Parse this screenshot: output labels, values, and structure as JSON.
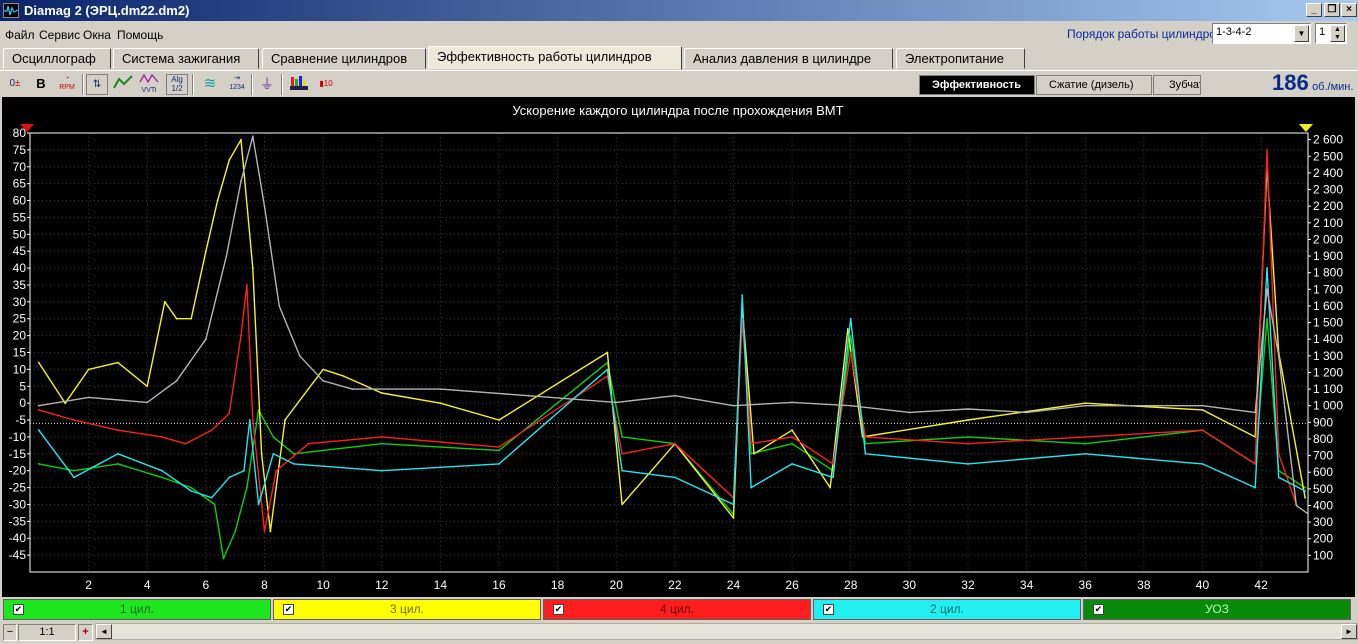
{
  "window": {
    "title": "Diamag 2 (ЭРЦ.dm22.dm2)",
    "minimize": "_",
    "restore": "❐",
    "close": "×"
  },
  "menu": [
    "Файл",
    "Сервис",
    "Окна",
    "Помощь"
  ],
  "cylinder_order": {
    "label": "Порядок работы цилиндров",
    "value": "1-3-4-2",
    "spin_value": "1"
  },
  "tabs": [
    "Осциллограф",
    "Система зажигания",
    "Сравнение цилиндров",
    "Эффективность работы цилиндров",
    "Анализ давления в цилиндре",
    "Электропитание"
  ],
  "active_tab": "Эффективность работы цилиндров",
  "toolbar_icons": [
    "zero-level-icon",
    "bold-b-icon",
    "rpm-gauge-icon",
    "cylinder-numbers-icon",
    "line-mode-icon",
    "vvti-icon",
    "algorithm-half-icon",
    "waveform-icon",
    "sequence-1234-icon",
    "filter-icon",
    "bars-engine-icon",
    "counter-10-icon"
  ],
  "toolbar_texts": {
    "zero": "0",
    "bold": "B",
    "rpm": "RPM",
    "seq": "1234",
    "alg": "Alg",
    "half": "1/2",
    "vvti": "VVTi",
    "ten": "10"
  },
  "subtabs": [
    "Эффективность",
    "Сжатие (дизель)",
    "Зубчат"
  ],
  "active_subtab": "Эффективность",
  "rpm": {
    "value": "186",
    "unit": "об./мин."
  },
  "chart_data": {
    "type": "line",
    "title": "Ускорение каждого цилиндра после прохождения ВМТ",
    "x_ticks": [
      2,
      4,
      6,
      8,
      10,
      12,
      14,
      16,
      18,
      20,
      22,
      24,
      26,
      28,
      30,
      32,
      34,
      36,
      38,
      40,
      42
    ],
    "xlim": [
      0,
      43.6
    ],
    "y_left_ticks": [
      80,
      75,
      70,
      65,
      60,
      55,
      50,
      45,
      40,
      35,
      30,
      25,
      20,
      15,
      10,
      5,
      0,
      -5,
      -10,
      -15,
      -20,
      -25,
      -30,
      -35,
      -40,
      -45
    ],
    "y_left_lim": [
      -50,
      80
    ],
    "y_right_ticks": [
      "2 600",
      "2 500",
      "2 400",
      "2 300",
      "2 200",
      "2 100",
      "2 000",
      "1 900",
      "1 800",
      "1 700",
      "1 600",
      "1 500",
      "1 400",
      "1 300",
      "1 200",
      "1 100",
      "1 000",
      "900",
      "800",
      "700",
      "600",
      "500",
      "400",
      "300",
      "200",
      "100"
    ],
    "y_right_lim": [
      0,
      2640
    ],
    "reference_line_y": -6,
    "grid": true,
    "series": [
      {
        "name": "1 цил.",
        "color": "#0cd10c",
        "axis": "left",
        "points": [
          [
            0.3,
            -18
          ],
          [
            1.5,
            -20
          ],
          [
            3,
            -18
          ],
          [
            4.5,
            -22
          ],
          [
            5.5,
            -25
          ],
          [
            6.3,
            -30
          ],
          [
            6.6,
            -46
          ],
          [
            7.0,
            -38
          ],
          [
            7.4,
            -25
          ],
          [
            7.8,
            -2
          ],
          [
            8.3,
            -10
          ],
          [
            9,
            -15
          ],
          [
            12,
            -12
          ],
          [
            16,
            -14
          ],
          [
            19.7,
            12
          ],
          [
            20.2,
            -10
          ],
          [
            22,
            -12
          ],
          [
            24.0,
            -33
          ],
          [
            24.3,
            30
          ],
          [
            24.6,
            -15
          ],
          [
            26,
            -12
          ],
          [
            27.4,
            -20
          ],
          [
            28.0,
            20
          ],
          [
            28.5,
            -12
          ],
          [
            32,
            -10
          ],
          [
            36,
            -12
          ],
          [
            40,
            -8
          ],
          [
            41.8,
            -18
          ],
          [
            42.2,
            25
          ],
          [
            42.6,
            -20
          ],
          [
            43.5,
            -25
          ]
        ]
      },
      {
        "name": "3 цил.",
        "color": "#f4f426",
        "axis": "left",
        "points": [
          [
            0.3,
            12
          ],
          [
            1.2,
            0
          ],
          [
            2,
            10
          ],
          [
            3,
            12
          ],
          [
            4,
            5
          ],
          [
            4.6,
            30
          ],
          [
            5.0,
            25
          ],
          [
            5.5,
            25
          ],
          [
            6.0,
            45
          ],
          [
            6.4,
            60
          ],
          [
            6.8,
            72
          ],
          [
            7.2,
            78
          ],
          [
            7.6,
            40
          ],
          [
            7.9,
            -15
          ],
          [
            8.2,
            -38
          ],
          [
            8.7,
            -5
          ],
          [
            10,
            10
          ],
          [
            10.7,
            8
          ],
          [
            12,
            3
          ],
          [
            14,
            0
          ],
          [
            16,
            -5
          ],
          [
            19.7,
            15
          ],
          [
            20.2,
            -30
          ],
          [
            22,
            -12
          ],
          [
            24.0,
            -34
          ],
          [
            24.3,
            28
          ],
          [
            24.7,
            -15
          ],
          [
            26,
            -8
          ],
          [
            27.3,
            -25
          ],
          [
            27.9,
            22
          ],
          [
            28.4,
            -10
          ],
          [
            32,
            -5
          ],
          [
            36,
            0
          ],
          [
            40,
            -2
          ],
          [
            41.8,
            -10
          ],
          [
            42.2,
            70
          ],
          [
            42.6,
            15
          ],
          [
            43.5,
            -28
          ]
        ]
      },
      {
        "name": "4 цил.",
        "color": "#ff1e1e",
        "axis": "left",
        "points": [
          [
            0.3,
            -2
          ],
          [
            1.5,
            -5
          ],
          [
            3,
            -8
          ],
          [
            4.5,
            -10
          ],
          [
            5.3,
            -12
          ],
          [
            6.2,
            -8
          ],
          [
            6.8,
            -3
          ],
          [
            7.2,
            20
          ],
          [
            7.4,
            35
          ],
          [
            7.6,
            -5
          ],
          [
            8.0,
            -38
          ],
          [
            8.4,
            -20
          ],
          [
            9.5,
            -12
          ],
          [
            12,
            -10
          ],
          [
            16,
            -13
          ],
          [
            19.7,
            8
          ],
          [
            20.2,
            -15
          ],
          [
            22,
            -12
          ],
          [
            24.0,
            -28
          ],
          [
            24.3,
            25
          ],
          [
            24.6,
            -12
          ],
          [
            26,
            -10
          ],
          [
            27.4,
            -18
          ],
          [
            28.0,
            15
          ],
          [
            28.5,
            -10
          ],
          [
            32,
            -12
          ],
          [
            36,
            -10
          ],
          [
            40,
            -8
          ],
          [
            41.8,
            -18
          ],
          [
            42.2,
            75
          ],
          [
            42.6,
            -15
          ],
          [
            43.2,
            -30
          ]
        ]
      },
      {
        "name": "2 цил.",
        "color": "#20e8f0",
        "axis": "left",
        "points": [
          [
            0.3,
            -8
          ],
          [
            1.5,
            -22
          ],
          [
            3,
            -15
          ],
          [
            4.5,
            -20
          ],
          [
            5.5,
            -26
          ],
          [
            6.2,
            -28
          ],
          [
            6.8,
            -22
          ],
          [
            7.3,
            -20
          ],
          [
            7.5,
            -5
          ],
          [
            7.8,
            -30
          ],
          [
            8.3,
            -15
          ],
          [
            9,
            -18
          ],
          [
            12,
            -20
          ],
          [
            16,
            -18
          ],
          [
            19.7,
            10
          ],
          [
            20.2,
            -20
          ],
          [
            22,
            -22
          ],
          [
            24.0,
            -30
          ],
          [
            24.3,
            32
          ],
          [
            24.6,
            -25
          ],
          [
            26,
            -18
          ],
          [
            27.4,
            -22
          ],
          [
            28.0,
            25
          ],
          [
            28.5,
            -15
          ],
          [
            32,
            -18
          ],
          [
            36,
            -15
          ],
          [
            40,
            -18
          ],
          [
            41.8,
            -25
          ],
          [
            42.2,
            40
          ],
          [
            42.6,
            -22
          ],
          [
            43.5,
            -26
          ]
        ]
      },
      {
        "name": "УОЗ",
        "color": "#b4b4b4",
        "axis": "right",
        "points": [
          [
            0.3,
            1000
          ],
          [
            2,
            1050
          ],
          [
            4,
            1020
          ],
          [
            5,
            1150
          ],
          [
            6,
            1400
          ],
          [
            6.7,
            1900
          ],
          [
            7.2,
            2350
          ],
          [
            7.6,
            2620
          ],
          [
            8.0,
            2200
          ],
          [
            8.5,
            1600
          ],
          [
            9.2,
            1300
          ],
          [
            10,
            1150
          ],
          [
            11,
            1100
          ],
          [
            14,
            1100
          ],
          [
            17,
            1060
          ],
          [
            20,
            1020
          ],
          [
            22,
            1060
          ],
          [
            24,
            1000
          ],
          [
            26,
            1020
          ],
          [
            28,
            1000
          ],
          [
            30,
            960
          ],
          [
            32,
            980
          ],
          [
            34,
            960
          ],
          [
            36,
            1000
          ],
          [
            38,
            1000
          ],
          [
            40,
            1000
          ],
          [
            41.8,
            960
          ],
          [
            42.2,
            1700
          ],
          [
            42.6,
            1300
          ],
          [
            43.2,
            400
          ],
          [
            43.6,
            350
          ]
        ]
      }
    ]
  },
  "legend": [
    {
      "label": "1 цил.",
      "color": "#1ee61e",
      "text_color": "#1a6a1a"
    },
    {
      "label": "3 цил.",
      "color": "#ffff00",
      "text_color": "#6a6a00"
    },
    {
      "label": "4 цил.",
      "color": "#ff1e1e",
      "text_color": "#6a0000"
    },
    {
      "label": "2 цил.",
      "color": "#22f0f0",
      "text_color": "#006a6a"
    },
    {
      "label": "УОЗ",
      "color": "#0a8a0a",
      "text_color": "#b4ffb4"
    }
  ],
  "status": {
    "zoom": "1:1",
    "zoom_in": "+",
    "scroll_left": "◄",
    "scroll_right": "►",
    "minus": "−"
  }
}
